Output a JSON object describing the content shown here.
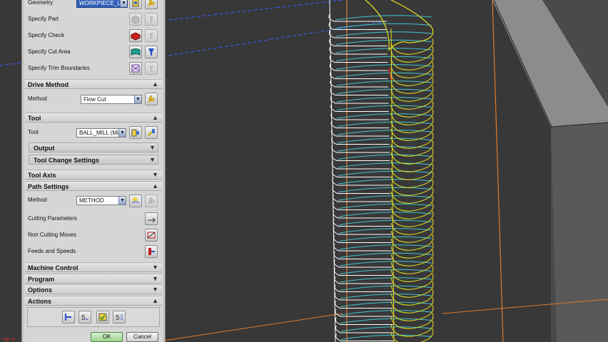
{
  "viewport": {
    "origin_label": "top vi",
    "colors": {
      "toolpath_cut": "#40c8d0",
      "toolpath_engage": "#e8e020",
      "toolpath_rapid": "#ffffff",
      "boundary": "#e07a2a",
      "datum": "#3a5cff"
    }
  },
  "geometry": {
    "label": "Geometry",
    "value": "WORKPIECE_L",
    "specify_part": "Specify Part",
    "specify_check": "Specify Check",
    "specify_cut_area": "Specify Cut Area",
    "specify_trim_boundaries": "Specify Trim Boundaries"
  },
  "drive_method": {
    "title": "Drive Method",
    "method_label": "Method",
    "method_value": "Flow Cut"
  },
  "tool": {
    "title": "Tool",
    "tool_label": "Tool",
    "tool_value": "BALL_MILL (Mil",
    "output": "Output",
    "tool_change_settings": "Tool Change Settings"
  },
  "tool_axis": {
    "title": "Tool Axis"
  },
  "path_settings": {
    "title": "Path Settings",
    "method_label": "Method",
    "method_value": "METHOD",
    "cutting_parameters": "Cutting Parameters",
    "non_cutting_moves": "Non Cutting Moves",
    "feeds_and_speeds": "Feeds and Speeds"
  },
  "machine_control": {
    "title": "Machine Control"
  },
  "program": {
    "title": "Program"
  },
  "options": {
    "title": "Options"
  },
  "actions": {
    "title": "Actions"
  },
  "buttons": {
    "ok": "OK",
    "cancel": "Cancel"
  }
}
